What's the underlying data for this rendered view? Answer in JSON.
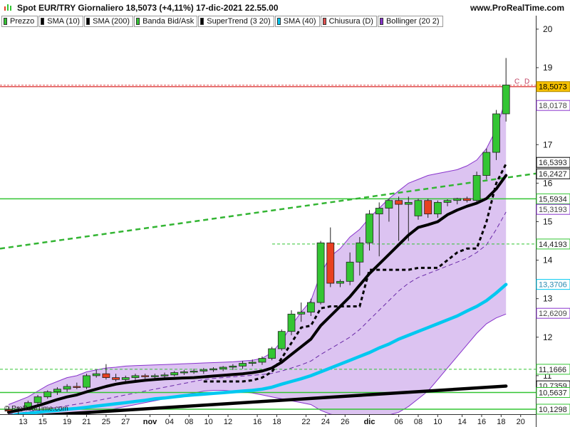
{
  "header": {
    "title": "Spot EUR/TRY Giornaliero 18,5073 (+4,11%) 17-dic-2021 22.55.00",
    "site": "www.ProRealTime.com"
  },
  "legend": [
    {
      "label": "Prezzo",
      "color": "#33c533"
    },
    {
      "label": "SMA (10)",
      "color": "#000000"
    },
    {
      "label": "SMA (200)",
      "color": "#000000"
    },
    {
      "label": "Banda Bid/Ask",
      "color": "#33c533"
    },
    {
      "label": "SuperTrend (3 20)",
      "color": "#000000"
    },
    {
      "label": "SMA (40)",
      "color": "#00c8f0"
    },
    {
      "label": "Chiusura (D)",
      "color": "#e05050"
    },
    {
      "label": "Bollinger (20 2)",
      "color": "#8833cc"
    }
  ],
  "watermark": "© ProRealTime.com",
  "chart_data": {
    "type": "candlestick",
    "ylim": [
      10,
      20.35
    ],
    "y_ticks": [
      11,
      12,
      13,
      14,
      15,
      16,
      17,
      19,
      20
    ],
    "x_ticks": [
      "13",
      "15",
      "19",
      "21",
      "25",
      "27",
      "nov",
      "04",
      "08",
      "10",
      "12",
      "16",
      "18",
      "22",
      "24",
      "26",
      "dic",
      "06",
      "08",
      "10",
      "14",
      "16",
      "18",
      "20"
    ],
    "candles": [
      {
        "o": 10.12,
        "h": 10.2,
        "l": 9.88,
        "c": 10.08
      },
      {
        "o": 10.08,
        "h": 10.2,
        "l": 10.0,
        "c": 10.12
      },
      {
        "o": 10.12,
        "h": 10.35,
        "l": 10.1,
        "c": 10.3
      },
      {
        "o": 10.3,
        "h": 10.5,
        "l": 10.25,
        "c": 10.45
      },
      {
        "o": 10.45,
        "h": 10.62,
        "l": 10.4,
        "c": 10.58
      },
      {
        "o": 10.58,
        "h": 10.7,
        "l": 10.5,
        "c": 10.65
      },
      {
        "o": 10.65,
        "h": 10.78,
        "l": 10.58,
        "c": 10.72
      },
      {
        "o": 10.72,
        "h": 10.82,
        "l": 10.65,
        "c": 10.7
      },
      {
        "o": 10.7,
        "h": 11.05,
        "l": 10.65,
        "c": 11.0
      },
      {
        "o": 11.0,
        "h": 11.15,
        "l": 10.95,
        "c": 11.05
      },
      {
        "o": 11.05,
        "h": 11.3,
        "l": 10.9,
        "c": 10.95
      },
      {
        "o": 10.95,
        "h": 11.05,
        "l": 10.85,
        "c": 10.9
      },
      {
        "o": 10.9,
        "h": 11.0,
        "l": 10.85,
        "c": 10.95
      },
      {
        "o": 10.95,
        "h": 11.05,
        "l": 10.88,
        "c": 11.0
      },
      {
        "o": 11.0,
        "h": 11.05,
        "l": 10.92,
        "c": 10.98
      },
      {
        "o": 10.98,
        "h": 11.05,
        "l": 10.92,
        "c": 11.0
      },
      {
        "o": 11.0,
        "h": 11.08,
        "l": 10.95,
        "c": 11.02
      },
      {
        "o": 11.02,
        "h": 11.12,
        "l": 10.98,
        "c": 11.08
      },
      {
        "o": 11.08,
        "h": 11.15,
        "l": 11.02,
        "c": 11.1
      },
      {
        "o": 11.1,
        "h": 11.18,
        "l": 11.05,
        "c": 11.12
      },
      {
        "o": 11.12,
        "h": 11.2,
        "l": 11.05,
        "c": 11.15
      },
      {
        "o": 11.15,
        "h": 11.22,
        "l": 11.1,
        "c": 11.18
      },
      {
        "o": 11.18,
        "h": 11.25,
        "l": 11.12,
        "c": 11.22
      },
      {
        "o": 11.22,
        "h": 11.3,
        "l": 11.15,
        "c": 11.25
      },
      {
        "o": 11.25,
        "h": 11.38,
        "l": 11.18,
        "c": 11.32
      },
      {
        "o": 11.32,
        "h": 11.42,
        "l": 11.25,
        "c": 11.35
      },
      {
        "o": 11.35,
        "h": 11.5,
        "l": 11.28,
        "c": 11.45
      },
      {
        "o": 11.45,
        "h": 11.75,
        "l": 11.4,
        "c": 11.7
      },
      {
        "o": 11.7,
        "h": 12.2,
        "l": 11.65,
        "c": 12.15
      },
      {
        "o": 12.15,
        "h": 12.7,
        "l": 12.05,
        "c": 12.6
      },
      {
        "o": 12.6,
        "h": 12.9,
        "l": 12.4,
        "c": 12.65
      },
      {
        "o": 12.65,
        "h": 13.0,
        "l": 12.55,
        "c": 12.9
      },
      {
        "o": 12.9,
        "h": 14.5,
        "l": 12.85,
        "c": 14.45
      },
      {
        "o": 14.45,
        "h": 14.85,
        "l": 13.3,
        "c": 13.4
      },
      {
        "o": 13.4,
        "h": 13.5,
        "l": 13.3,
        "c": 13.45
      },
      {
        "o": 13.45,
        "h": 14.2,
        "l": 13.35,
        "c": 13.95
      },
      {
        "o": 13.95,
        "h": 14.6,
        "l": 13.6,
        "c": 14.45
      },
      {
        "o": 14.45,
        "h": 15.3,
        "l": 14.25,
        "c": 15.2
      },
      {
        "o": 15.2,
        "h": 15.5,
        "l": 14.1,
        "c": 15.35
      },
      {
        "o": 15.35,
        "h": 15.6,
        "l": 15.0,
        "c": 15.55
      },
      {
        "o": 15.55,
        "h": 15.65,
        "l": 14.5,
        "c": 15.45
      },
      {
        "o": 15.45,
        "h": 15.65,
        "l": 14.5,
        "c": 15.5
      },
      {
        "o": 15.15,
        "h": 15.6,
        "l": 15.05,
        "c": 15.55
      },
      {
        "o": 15.55,
        "h": 15.6,
        "l": 15.1,
        "c": 15.2
      },
      {
        "o": 15.2,
        "h": 15.55,
        "l": 15.1,
        "c": 15.5
      },
      {
        "o": 15.5,
        "h": 15.58,
        "l": 15.4,
        "c": 15.55
      },
      {
        "o": 15.55,
        "h": 15.62,
        "l": 15.45,
        "c": 15.6
      },
      {
        "o": 15.6,
        "h": 15.65,
        "l": 15.5,
        "c": 15.55
      },
      {
        "o": 15.55,
        "h": 16.3,
        "l": 15.45,
        "c": 16.2
      },
      {
        "o": 16.2,
        "h": 16.9,
        "l": 16.1,
        "c": 16.8
      },
      {
        "o": 16.8,
        "h": 17.9,
        "l": 16.6,
        "c": 17.8
      },
      {
        "o": 17.8,
        "h": 19.25,
        "l": 17.6,
        "c": 18.55
      }
    ],
    "bollinger_upper": [
      10.25,
      10.35,
      10.45,
      10.6,
      10.75,
      10.85,
      10.95,
      11.0,
      11.1,
      11.15,
      11.2,
      11.22,
      11.25,
      11.26,
      11.27,
      11.28,
      11.29,
      11.3,
      11.31,
      11.32,
      11.33,
      11.34,
      11.35,
      11.36,
      11.38,
      11.4,
      11.45,
      11.6,
      11.9,
      12.3,
      12.65,
      12.95,
      13.65,
      14.1,
      14.3,
      14.6,
      14.8,
      15.1,
      15.35,
      15.6,
      15.8,
      16.0,
      16.1,
      16.2,
      16.25,
      16.3,
      16.35,
      16.45,
      16.6,
      16.9,
      17.4,
      18.2
    ],
    "bollinger_lower": [
      9.6,
      9.65,
      9.7,
      9.75,
      9.8,
      9.85,
      9.9,
      9.95,
      10.0,
      10.05,
      10.1,
      10.15,
      10.2,
      10.25,
      10.3,
      10.35,
      10.4,
      10.45,
      10.5,
      10.55,
      10.6,
      10.62,
      10.62,
      10.6,
      10.58,
      10.55,
      10.5,
      10.45,
      10.4,
      10.35,
      10.3,
      10.25,
      10.1,
      10.0,
      9.95,
      9.95,
      9.95,
      9.96,
      9.97,
      9.98,
      10.05,
      10.2,
      10.4,
      10.6,
      10.9,
      11.2,
      11.5,
      11.8,
      12.1,
      12.35,
      12.5,
      12.6
    ],
    "sma10": [
      10.05,
      10.1,
      10.15,
      10.22,
      10.3,
      10.38,
      10.45,
      10.5,
      10.58,
      10.65,
      10.72,
      10.78,
      10.82,
      10.85,
      10.88,
      10.9,
      10.92,
      10.93,
      10.94,
      10.95,
      10.97,
      10.99,
      11.01,
      11.03,
      11.05,
      11.08,
      11.12,
      11.2,
      11.35,
      11.55,
      11.75,
      11.95,
      12.3,
      12.55,
      12.8,
      13.05,
      13.35,
      13.65,
      13.9,
      14.15,
      14.4,
      14.65,
      14.85,
      14.92,
      15.0,
      15.18,
      15.3,
      15.4,
      15.48,
      15.6,
      15.85,
      16.2
    ],
    "supertrend": [
      null,
      null,
      null,
      null,
      null,
      null,
      null,
      null,
      null,
      null,
      null,
      null,
      null,
      null,
      null,
      null,
      null,
      null,
      null,
      null,
      10.85,
      10.85,
      10.85,
      10.85,
      10.85,
      10.88,
      10.95,
      11.1,
      11.45,
      11.85,
      12.25,
      12.3,
      12.75,
      12.8,
      12.8,
      12.8,
      12.8,
      13.75,
      13.75,
      13.75,
      13.75,
      13.75,
      13.8,
      13.8,
      13.8,
      14.0,
      14.2,
      14.3,
      14.3,
      15.0,
      16.0,
      16.5
    ],
    "sma40": [
      9.95,
      10.0,
      10.02,
      10.05,
      10.08,
      10.1,
      10.13,
      10.15,
      10.18,
      10.21,
      10.24,
      10.27,
      10.3,
      10.33,
      10.36,
      10.4,
      10.42,
      10.45,
      10.48,
      10.5,
      10.52,
      10.54,
      10.56,
      10.58,
      10.6,
      10.62,
      10.65,
      10.7,
      10.78,
      10.85,
      10.92,
      11.0,
      11.1,
      11.2,
      11.3,
      11.4,
      11.5,
      11.6,
      11.72,
      11.82,
      11.95,
      12.05,
      12.15,
      12.25,
      12.35,
      12.45,
      12.55,
      12.68,
      12.8,
      12.95,
      13.15,
      13.37
    ],
    "sma20_dashed": [
      10.0,
      10.03,
      10.06,
      10.1,
      10.14,
      10.18,
      10.22,
      10.26,
      10.3,
      10.35,
      10.4,
      10.45,
      10.5,
      10.55,
      10.6,
      10.65,
      10.7,
      10.75,
      10.8,
      10.85,
      10.9,
      10.93,
      10.95,
      10.97,
      10.99,
      11.01,
      11.03,
      11.06,
      11.12,
      11.2,
      11.28,
      11.38,
      11.55,
      11.7,
      11.85,
      12.0,
      12.2,
      12.45,
      12.7,
      12.95,
      13.2,
      13.4,
      13.55,
      13.65,
      13.75,
      13.85,
      13.95,
      14.05,
      14.2,
      14.4,
      14.8,
      15.25
    ],
    "sma200": {
      "start": 9.9,
      "end": 10.73
    },
    "trendline": {
      "start": 14.3,
      "end": 16.25
    },
    "hlines": [
      {
        "value": 18.5073,
        "color": "#e05050",
        "style": "solid"
      },
      {
        "value": 15.5934,
        "color": "#33c533",
        "style": "solid"
      },
      {
        "value": 14.4193,
        "color": "#33c533",
        "style": "dashed"
      },
      {
        "value": 11.1666,
        "color": "#33c533",
        "style": "dashed"
      },
      {
        "value": 10.5637,
        "color": "#33c533",
        "style": "solid"
      },
      {
        "value": 10.1298,
        "color": "#33c533",
        "style": "solid"
      }
    ],
    "price_labels": [
      {
        "value": 18.5073,
        "text": "18,5073",
        "bg": "#f5c000",
        "fg": "#000",
        "border": "#b08800"
      },
      {
        "value": 18.0178,
        "text": "18,0178",
        "bg": "#ffffff",
        "fg": "#444",
        "border": "#8833cc"
      },
      {
        "value": 16.5393,
        "text": "16,5393",
        "bg": "#ffffff",
        "fg": "#222",
        "border": "#000000"
      },
      {
        "value": 16.2427,
        "text": "16,2427",
        "bg": "#ffffff",
        "fg": "#222",
        "border": "#000000"
      },
      {
        "value": 15.5934,
        "text": "15,5934",
        "bg": "#ffffff",
        "fg": "#222",
        "border": "#33c533"
      },
      {
        "value": 15.3193,
        "text": "15,3193",
        "bg": "#ffffff",
        "fg": "#444",
        "border": "#8833cc"
      },
      {
        "value": 14.4193,
        "text": "14,4193",
        "bg": "#ffffff",
        "fg": "#222",
        "border": "#33c533"
      },
      {
        "value": 13.3706,
        "text": "13,3706",
        "bg": "#ffffff",
        "fg": "#2a8ab0",
        "border": "#00c8f0"
      },
      {
        "value": 12.6209,
        "text": "12,6209",
        "bg": "#ffffff",
        "fg": "#444",
        "border": "#8833cc"
      },
      {
        "value": 11.1666,
        "text": "11,1666",
        "bg": "#ffffff",
        "fg": "#222",
        "border": "#33c533"
      },
      {
        "value": 10.7359,
        "text": "10,7359",
        "bg": "#ffffff",
        "fg": "#222",
        "border": "#000000"
      },
      {
        "value": 10.5637,
        "text": "10,5637",
        "bg": "#ffffff",
        "fg": "#222",
        "border": "#33c533"
      },
      {
        "value": 10.1298,
        "text": "10,1298",
        "bg": "#ffffff",
        "fg": "#222",
        "border": "#33c533"
      }
    ],
    "cd_label": "C D",
    "colors": {
      "up": "#33c533",
      "down": "#e84020",
      "wick": "#222222",
      "bb_fill": "#d6b8ee",
      "bb_line": "#8833cc",
      "sma40": "#00c8f0"
    }
  }
}
